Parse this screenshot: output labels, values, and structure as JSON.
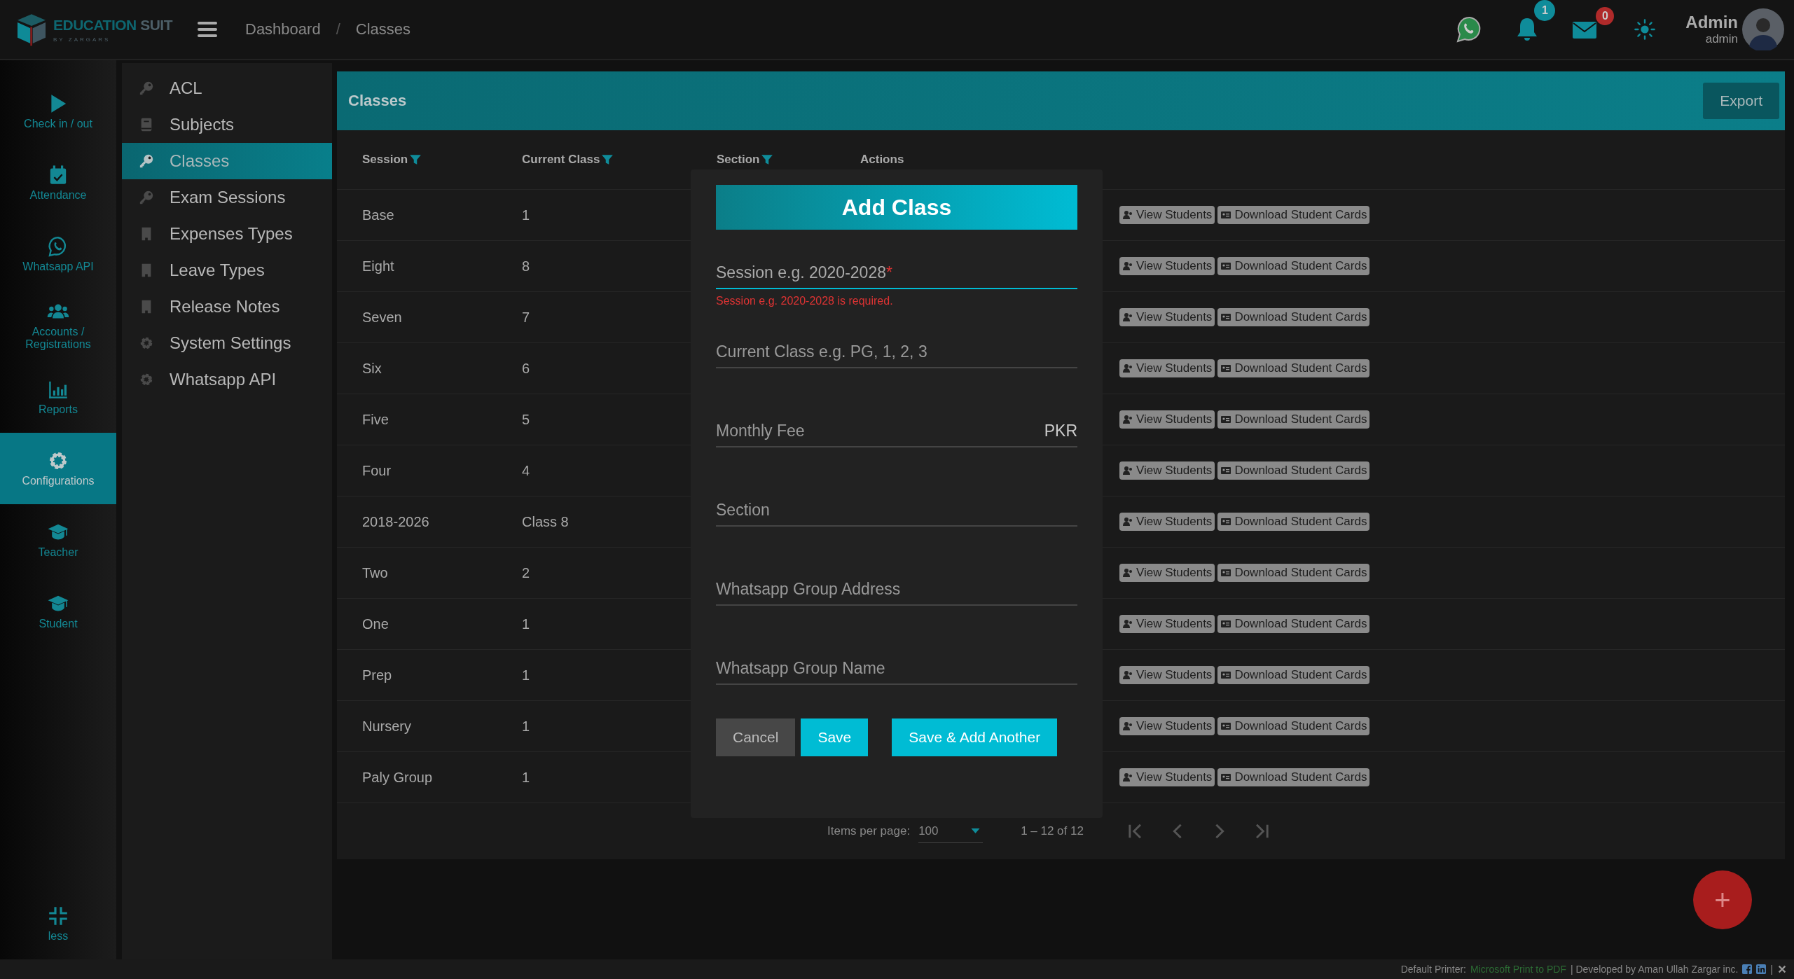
{
  "app": {
    "logo_title": "EDUCATION",
    "logo_title_2": "SUIT",
    "logo_subtitle": "BY ZARGARS"
  },
  "breadcrumbs": [
    "Dashboard",
    "Classes"
  ],
  "breadcrumb_separator": "/",
  "header": {
    "notifications_count": "1",
    "messages_count": "0",
    "user_name": "Admin",
    "user_role": "admin"
  },
  "rail": [
    {
      "label": "Check in / out",
      "selected": false
    },
    {
      "label": "Attendance",
      "selected": false
    },
    {
      "label": "Whatsapp API",
      "selected": false
    },
    {
      "label": "Accounts / Registrations",
      "selected": false
    },
    {
      "label": "Reports",
      "selected": false
    },
    {
      "label": "Configurations",
      "selected": true
    },
    {
      "label": "Teacher",
      "selected": false
    },
    {
      "label": "Student",
      "selected": false
    }
  ],
  "rail_toggle": "less",
  "submenu": [
    {
      "label": "ACL",
      "selected": false
    },
    {
      "label": "Subjects",
      "selected": false
    },
    {
      "label": "Classes",
      "selected": true
    },
    {
      "label": "Exam Sessions",
      "selected": false
    },
    {
      "label": "Expenses Types",
      "selected": false
    },
    {
      "label": "Leave Types",
      "selected": false
    },
    {
      "label": "Release Notes",
      "selected": false
    },
    {
      "label": "System Settings",
      "selected": false
    },
    {
      "label": "Whatsapp API",
      "selected": false
    }
  ],
  "panel": {
    "title": "Classes",
    "export": "Export"
  },
  "table": {
    "columns": [
      {
        "label": "Session",
        "filter": true
      },
      {
        "label": "Current Class",
        "filter": true
      },
      {
        "label": "Section",
        "filter": true
      },
      {
        "label": "Actions",
        "filter": false
      }
    ],
    "rows": [
      {
        "session": "Base",
        "class": "1",
        "actions": [
          "View Students",
          "Download Student Cards"
        ]
      },
      {
        "session": "Eight",
        "class": "8",
        "actions": [
          "View Students",
          "Download Student Cards"
        ]
      },
      {
        "session": "Seven",
        "class": "7",
        "actions": [
          "View Students",
          "Download Student Cards"
        ]
      },
      {
        "session": "Six",
        "class": "6",
        "actions": [
          "View Students",
          "Download Student Cards"
        ]
      },
      {
        "session": "Five",
        "class": "5",
        "actions": [
          "View Students",
          "Download Student Cards"
        ]
      },
      {
        "session": "Four",
        "class": "4",
        "actions": [
          "View Students",
          "Download Student Cards"
        ]
      },
      {
        "session": "2018-2026",
        "class": "Class 8",
        "actions": [
          "View Students",
          "Download Student Cards"
        ]
      },
      {
        "session": "Two",
        "class": "2",
        "actions": [
          "View Students",
          "Download Student Cards"
        ]
      },
      {
        "session": "One",
        "class": "1",
        "actions": [
          "View Students",
          "Download Student Cards"
        ]
      },
      {
        "session": "Prep",
        "class": "1",
        "actions": [
          "View Students",
          "Download Student Cards"
        ]
      },
      {
        "session": "Nursery",
        "class": "1",
        "actions": [
          "View Students",
          "Download Student Cards"
        ]
      },
      {
        "session": "Paly Group",
        "class": "1",
        "actions": [
          "View Students",
          "Download Student Cards"
        ]
      }
    ]
  },
  "pagination": {
    "label": "Items per page:",
    "value": "100",
    "range": "1 – 12 of 12"
  },
  "dialog": {
    "title": "Add Class",
    "fields": [
      {
        "placeholder": "Session e.g. 2020-2028",
        "required": true,
        "focused": true,
        "error": "Session e.g. 2020-2028 is required."
      },
      {
        "placeholder": "Current Class e.g. PG, 1, 2, 3",
        "required": false,
        "focused": false
      },
      {
        "placeholder": "Monthly Fee",
        "required": false,
        "focused": false,
        "suffix": "PKR"
      },
      {
        "placeholder": "Section",
        "required": false,
        "focused": false
      },
      {
        "placeholder": "Whatsapp Group Address",
        "required": false,
        "focused": false
      },
      {
        "placeholder": "Whatsapp Group Name",
        "required": false,
        "focused": false
      }
    ],
    "required_mark": "*",
    "buttons": [
      {
        "label": "Cancel",
        "kind": "neutral"
      },
      {
        "label": "Save",
        "kind": "primary"
      },
      {
        "label": "Save & Add Another",
        "kind": "primary"
      }
    ]
  },
  "fab": "+",
  "footer": {
    "printer_label": "Default Printer:",
    "printer": "Microsoft Print to PDF",
    "developer": "| Developed by Aman Ullah Zargar inc.",
    "separator": "|"
  }
}
